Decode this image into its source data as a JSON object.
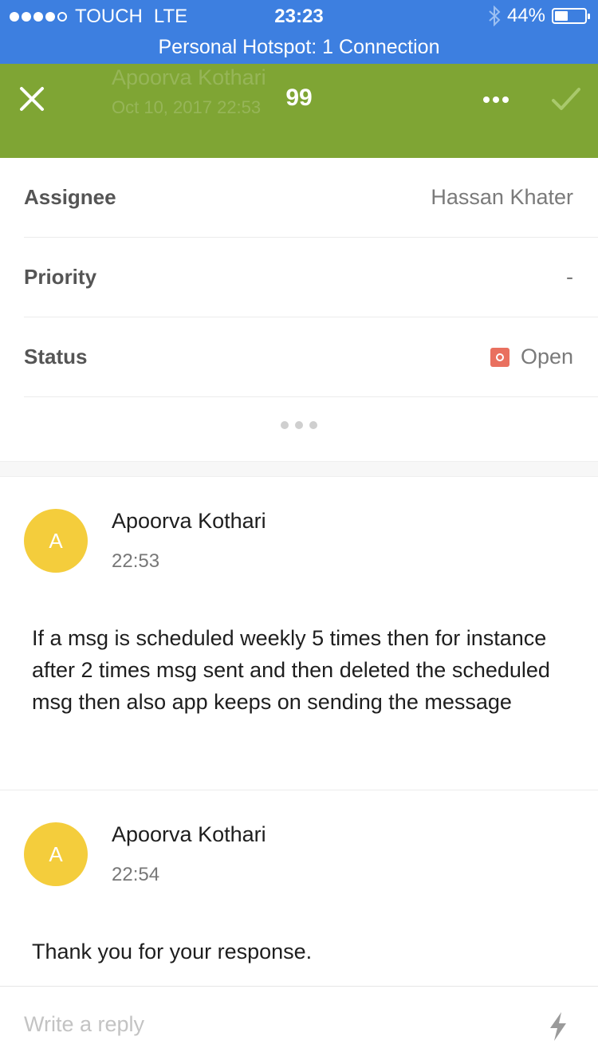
{
  "status_bar": {
    "carrier": "TOUCH",
    "network": "LTE",
    "time": "23:23",
    "battery": "44%",
    "battery_level": 0.44,
    "signal_bars": 4,
    "signal_max": 5
  },
  "hotspot_banner": "Personal Hotspot: 1 Connection",
  "header": {
    "faded_name": "Apoorva Kothari",
    "faded_date": "Oct 10, 2017 22:53",
    "count": "99",
    "background_color": "#7fa534"
  },
  "properties": [
    {
      "label": "Assignee",
      "value": "Hassan Khater"
    },
    {
      "label": "Priority",
      "value": "-"
    },
    {
      "label": "Status",
      "value": "Open",
      "status_color": "#e9705f"
    }
  ],
  "messages": [
    {
      "avatar_initial": "A",
      "author": "Apoorva Kothari",
      "time": "22:53",
      "body": "If a msg is scheduled weekly 5 times then for instance after 2 times msg sent and then deleted the scheduled msg then also app keeps on sending the message"
    },
    {
      "avatar_initial": "A",
      "author": "Apoorva Kothari",
      "time": "22:54",
      "body": "Thank you for your response."
    }
  ],
  "reply": {
    "placeholder": "Write a reply"
  },
  "icons": {
    "close": "close-icon",
    "more": "more-icon",
    "confirm": "checkmark-icon",
    "bluetooth": "bluetooth-icon",
    "quick_reply": "lightning-icon"
  }
}
